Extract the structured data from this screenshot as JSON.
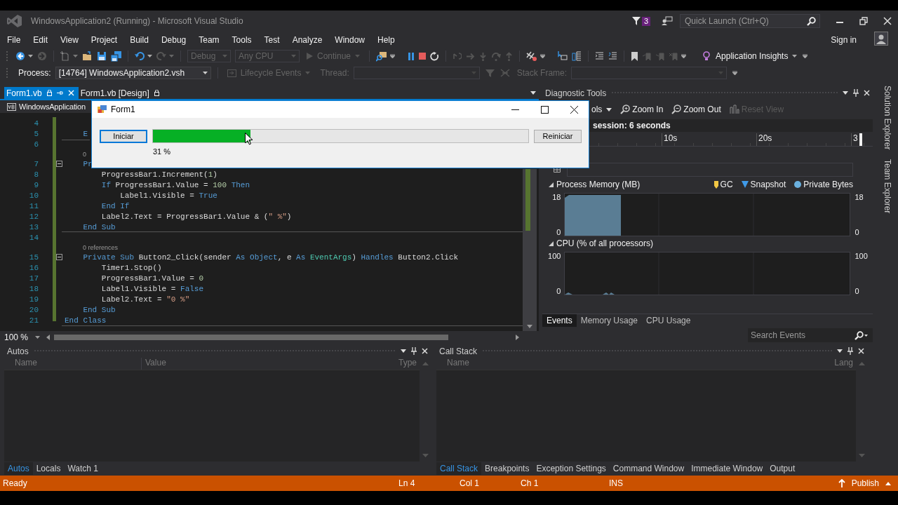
{
  "window": {
    "title": "WindowsApplication2 (Running) - Microsoft Visual Studio",
    "notification_count": "3",
    "quick_launch": {
      "placeholder": "Quick Launch (Ctrl+Q)"
    }
  },
  "menu": [
    "File",
    "Edit",
    "View",
    "Project",
    "Build",
    "Debug",
    "Team",
    "Tools",
    "Test",
    "Analyze",
    "Window",
    "Help"
  ],
  "account": {
    "sign_in": "Sign in"
  },
  "toolbar": {
    "configuration": {
      "value": "Debug",
      "disabled": true
    },
    "platform": {
      "value": "Any CPU",
      "disabled": true
    },
    "continue": {
      "label": "Continue",
      "disabled": true
    },
    "application_insights": "Application Insights"
  },
  "debug_location": {
    "process_label": "Process:",
    "process": "[14764] WindowsApplication2.vsh",
    "lifecycle": {
      "label": "Lifecycle Events",
      "disabled": true
    },
    "thread_label": "Thread:",
    "stack_frame_label": "Stack Frame:"
  },
  "editor_tabs": [
    {
      "label": "Form1.vb",
      "selected": true
    },
    {
      "label": "Form1.vb [Design]",
      "selected": false
    }
  ],
  "editor": {
    "navigation": "WindowsApplication",
    "zoom": "100 %",
    "lines": [
      {
        "kind": "code",
        "number": "4"
      },
      {
        "kind": "code",
        "number": "5",
        "code": [
          {
            "kind": "keyword",
            "text": "    E"
          }
        ]
      },
      {
        "kind": "code",
        "number": "6"
      },
      {
        "kind": "codelens",
        "text": "0"
      },
      {
        "kind": "code",
        "number": "7",
        "fold": true,
        "code": [
          {
            "kind": "keyword",
            "text": "    Pr"
          }
        ]
      },
      {
        "kind": "code",
        "number": "8",
        "code": [
          {
            "kind": "plain",
            "text": "        ProgressBar1.Increment("
          },
          {
            "kind": "number",
            "text": "1"
          },
          {
            "kind": "plain",
            "text": ")"
          }
        ]
      },
      {
        "kind": "code",
        "number": "9",
        "code": [
          {
            "kind": "keyword",
            "text": "        If"
          },
          {
            "kind": "plain",
            "text": " ProgressBar1.Value = "
          },
          {
            "kind": "number",
            "text": "100"
          },
          {
            "kind": "keyword",
            "text": " Then"
          }
        ]
      },
      {
        "kind": "code",
        "number": "10",
        "code": [
          {
            "kind": "plain",
            "text": "            Label1.Visible = "
          },
          {
            "kind": "keyword",
            "text": "True"
          }
        ]
      },
      {
        "kind": "code",
        "number": "11",
        "code": [
          {
            "kind": "keyword",
            "text": "        End If"
          }
        ]
      },
      {
        "kind": "code",
        "number": "12",
        "code": [
          {
            "kind": "plain",
            "text": "        Label2.Text = ProgressBar1.Value & ("
          },
          {
            "kind": "string",
            "text": "\" %\""
          },
          {
            "kind": "plain",
            "text": ")"
          }
        ]
      },
      {
        "kind": "code",
        "number": "13",
        "code": [
          {
            "kind": "keyword",
            "text": "    End Sub"
          }
        ]
      },
      {
        "kind": "code",
        "number": "14"
      },
      {
        "kind": "codelens",
        "text": "0 references"
      },
      {
        "kind": "code",
        "number": "15",
        "fold": true,
        "code": [
          {
            "kind": "keyword",
            "text": "    Private Sub"
          },
          {
            "kind": "plain",
            "text": " Button2_Click(sender "
          },
          {
            "kind": "keyword",
            "text": "As Object"
          },
          {
            "kind": "plain",
            "text": ", e "
          },
          {
            "kind": "keyword",
            "text": "As"
          },
          {
            "kind": "type",
            "text": " EventArgs"
          },
          {
            "kind": "plain",
            "text": ") "
          },
          {
            "kind": "keyword",
            "text": "Handles"
          },
          {
            "kind": "plain",
            "text": " Button2.Click"
          }
        ]
      },
      {
        "kind": "code",
        "number": "16",
        "code": [
          {
            "kind": "plain",
            "text": "        Timer1.Stop()"
          }
        ]
      },
      {
        "kind": "code",
        "number": "17",
        "code": [
          {
            "kind": "plain",
            "text": "        ProgressBar1.Value = "
          },
          {
            "kind": "number",
            "text": "0"
          }
        ]
      },
      {
        "kind": "code",
        "number": "18",
        "code": [
          {
            "kind": "plain",
            "text": "        Label1.Visible = "
          },
          {
            "kind": "keyword",
            "text": "False"
          }
        ]
      },
      {
        "kind": "code",
        "number": "19",
        "code": [
          {
            "kind": "plain",
            "text": "        Label2.Text = "
          },
          {
            "kind": "string",
            "text": "\"0 %\""
          }
        ]
      },
      {
        "kind": "code",
        "number": "20",
        "code": [
          {
            "kind": "keyword",
            "text": "    End Sub"
          }
        ]
      },
      {
        "kind": "code",
        "number": "21",
        "code": [
          {
            "kind": "keyword",
            "text": "End Class"
          }
        ]
      }
    ]
  },
  "form_window": {
    "title": "Form1",
    "start_button": "Iniciar",
    "progress": {
      "level": 0.26
    },
    "percent": "31 %",
    "reset_button": "Reiniciar"
  },
  "diagnostic_tools": {
    "title": "Diagnostic Tools",
    "tools_menu": "ols",
    "zoom_in": "Zoom In",
    "zoom_out": "Zoom Out",
    "reset_view": {
      "label": "Reset View",
      "disabled": true
    },
    "session": "session: 6 seconds",
    "timeline_labels": [
      "10s",
      "20s",
      "3"
    ],
    "memory": {
      "title": "Process Memory (MB)",
      "legend": [
        {
          "label": "GC",
          "color": "#f2c744"
        },
        {
          "label": "Snapshot",
          "color": "#3f9ae8"
        },
        {
          "label": "Private Bytes",
          "color": "#6ab0de"
        }
      ],
      "left_axis": [
        "18",
        "0"
      ],
      "right_axis": [
        "18",
        "0"
      ]
    },
    "cpu": {
      "title": "CPU (% of all processors)",
      "left_axis": [
        "100",
        "0"
      ],
      "right_axis": [
        "100",
        "0"
      ]
    },
    "tabs": [
      {
        "label": "Events",
        "selected": true
      },
      {
        "label": "Memory Usage",
        "selected": false
      },
      {
        "label": "CPU Usage",
        "selected": false
      }
    ],
    "search": {
      "placeholder": "Search Events"
    }
  },
  "side_tabs": [
    "Solution Explorer",
    "Team Explorer"
  ],
  "autos": {
    "title": "Autos",
    "columns": [
      "Name",
      "Value",
      "Type"
    ],
    "tabs": [
      {
        "label": "Autos",
        "selected": true
      },
      {
        "label": "Locals",
        "selected": false
      },
      {
        "label": "Watch 1",
        "selected": false
      }
    ]
  },
  "call_stack": {
    "title": "Call Stack",
    "columns": [
      "Name",
      "Lang"
    ],
    "tabs": [
      {
        "label": "Call Stack",
        "selected": true
      },
      {
        "label": "Breakpoints",
        "selected": false
      },
      {
        "label": "Exception Settings",
        "selected": false
      },
      {
        "label": "Command Window",
        "selected": false
      },
      {
        "label": "Immediate Window",
        "selected": false
      },
      {
        "label": "Output",
        "selected": false
      }
    ]
  },
  "status_bar": {
    "state": "Ready",
    "line": "Ln 4",
    "column": "Col 1",
    "char": "Ch 1",
    "mode": "INS",
    "publish": "Publish"
  }
}
